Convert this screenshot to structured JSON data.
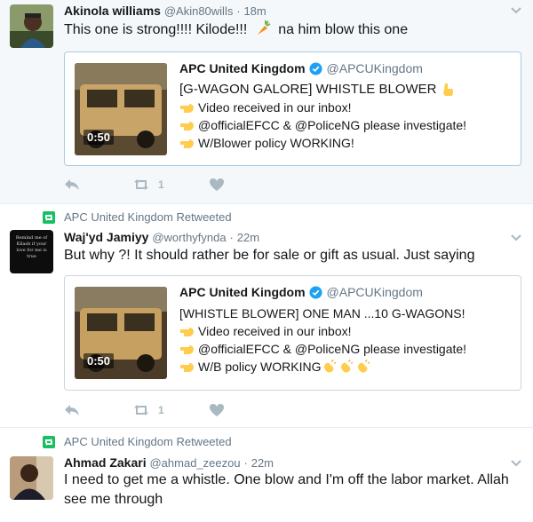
{
  "tweets": [
    {
      "name": "Akinola williams",
      "handle": "@Akin80wills",
      "time": "18m",
      "text_before": "This one is strong!!!! Kilode!!!",
      "text_after": "na him blow this one",
      "quote": {
        "name": "APC United Kingdom",
        "handle": "@APCUKingdom",
        "line1": "[G-WAGON GALORE] WHISTLE BLOWER",
        "line2": "Video received in our inbox!",
        "line3": "@officialEFCC & @PoliceNG please investigate!",
        "line4": "W/Blower policy WORKING!",
        "duration": "0:50"
      },
      "retweet_count": "1"
    },
    {
      "context": "APC United Kingdom Retweeted",
      "name": "Waj'yd Jamiyy",
      "handle": "@worthyfynda",
      "time": "22m",
      "avatar_text": "Remind me of Kilash if your love for me is true",
      "text": "But why ?! It should rather be for sale or gift as usual. Just saying",
      "quote": {
        "name": "APC United Kingdom",
        "handle": "@APCUKingdom",
        "line1": "[WHISTLE BLOWER] ONE MAN ...10 G-WAGONS!",
        "line2": "Video received in our inbox!",
        "line3": "@officialEFCC & @PoliceNG please investigate!",
        "line4": "W/B policy WORKING",
        "duration": "0:50"
      },
      "retweet_count": "1"
    },
    {
      "context": "APC United Kingdom Retweeted",
      "name": "Ahmad Zakari",
      "handle": "@ahmad_zeezou",
      "time": "22m",
      "text": "I need to get me a whistle. One blow and I'm off the labor market. Allah see me through"
    }
  ],
  "separator": "·",
  "colors": {
    "accent_blue": "#1da1f2",
    "muted_gray": "#657786",
    "icon_gray": "#aab8c2",
    "retweet_green": "#17bf63",
    "highlight_bg": "#f5f8fa"
  },
  "icons": [
    "caret-down-icon",
    "reply-icon",
    "retweet-icon",
    "like-icon",
    "verified-badge-icon",
    "pointing-hand-emoji",
    "clapping-hands-emoji",
    "carrot-emoji"
  ]
}
